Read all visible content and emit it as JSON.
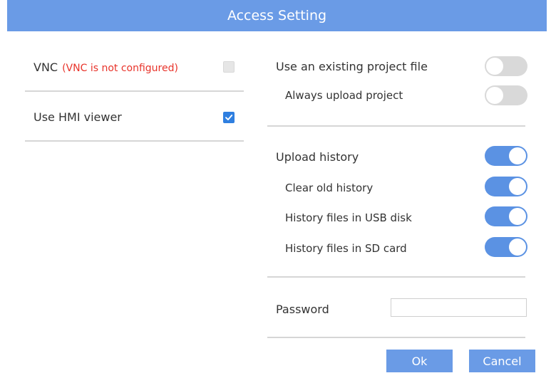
{
  "dialog": {
    "title": "Access Setting"
  },
  "left_panel": {
    "vnc": {
      "label": "VNC",
      "warning": "(VNC is not configured)",
      "checked": false
    },
    "hmi_viewer": {
      "label": "Use HMI viewer",
      "checked": true
    }
  },
  "right_panel": {
    "project": {
      "use_existing": {
        "label": "Use an existing project file",
        "enabled": false
      },
      "always_upload": {
        "label": "Always upload project",
        "enabled": false
      }
    },
    "history": {
      "upload_history": {
        "label": "Upload history",
        "enabled": true
      },
      "clear_old": {
        "label": "Clear old history",
        "enabled": true
      },
      "usb_disk": {
        "label": "History files in USB disk",
        "enabled": true
      },
      "sd_card": {
        "label": "History files in SD card",
        "enabled": true
      }
    },
    "password": {
      "label": "Password",
      "value": ""
    }
  },
  "buttons": {
    "ok": "Ok",
    "cancel": "Cancel"
  },
  "colors": {
    "accent": "#6a9be6",
    "toggle_on": "#5b92e3",
    "toggle_off": "#d9d9d9",
    "checkbox_on": "#2f7fe0",
    "warning": "#e8332a"
  }
}
